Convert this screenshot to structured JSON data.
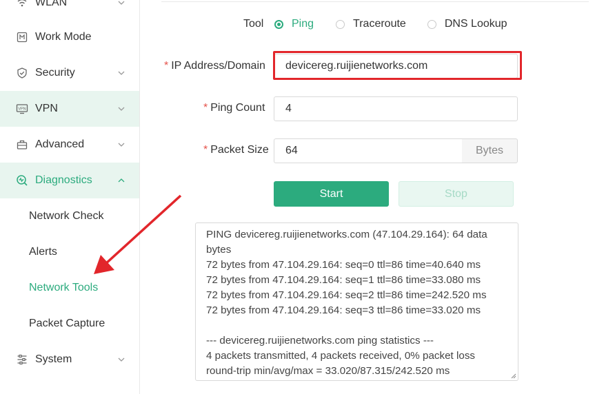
{
  "sidebar": {
    "items": [
      {
        "label": "WLAN",
        "icon": "wifi-icon"
      },
      {
        "label": "Work Mode",
        "icon": "work-mode-icon"
      },
      {
        "label": "Security",
        "icon": "shield-icon"
      },
      {
        "label": "VPN",
        "icon": "vpn-icon"
      },
      {
        "label": "Advanced",
        "icon": "toolbox-icon"
      },
      {
        "label": "Diagnostics",
        "icon": "diagnostics-icon"
      }
    ],
    "subitems": [
      {
        "label": "Network Check"
      },
      {
        "label": "Alerts"
      },
      {
        "label": "Network Tools"
      },
      {
        "label": "Packet Capture"
      }
    ],
    "last_item": {
      "label": "System",
      "icon": "system-icon"
    }
  },
  "form": {
    "tool_label": "Tool",
    "tools": [
      "Ping",
      "Traceroute",
      "DNS Lookup"
    ],
    "selected_tool": "Ping",
    "ip_label": "IP Address/Domain",
    "ip_value": "devicereg.ruijienetworks.com",
    "count_label": "Ping Count",
    "count_value": "4",
    "size_label": "Packet Size",
    "size_value": "64",
    "size_unit": "Bytes",
    "required_mark": "*",
    "start_label": "Start",
    "stop_label": "Stop"
  },
  "output": {
    "lines": [
      "PING devicereg.ruijienetworks.com (47.104.29.164): 64 data",
      "bytes",
      "72 bytes from 47.104.29.164: seq=0 ttl=86 time=40.640 ms",
      "72 bytes from 47.104.29.164: seq=1 ttl=86 time=33.080 ms",
      "72 bytes from 47.104.29.164: seq=2 ttl=86 time=242.520 ms",
      "72 bytes from 47.104.29.164: seq=3 ttl=86 time=33.020 ms",
      "",
      "--- devicereg.ruijienetworks.com ping statistics ---",
      "4 packets transmitted, 4 packets received, 0% packet loss",
      "round-trip min/avg/max = 33.020/87.315/242.520 ms"
    ]
  },
  "colors": {
    "accent": "#2cab7e",
    "highlight": "#e2262b",
    "active_bg": "#e8f5ef"
  }
}
